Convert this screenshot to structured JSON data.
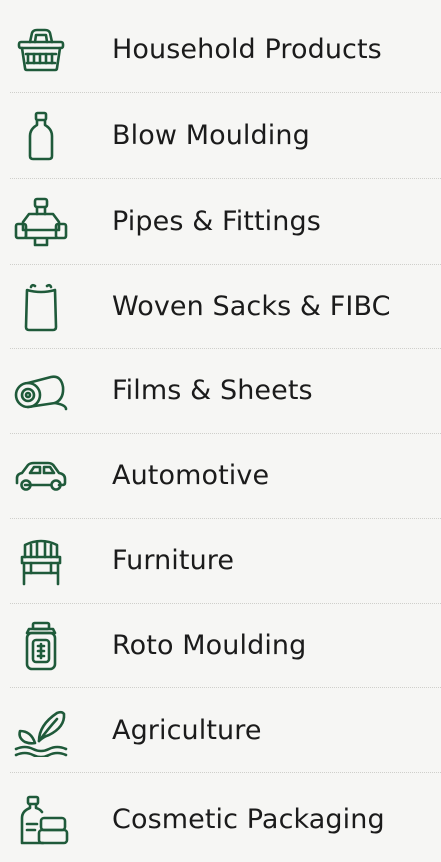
{
  "categories": [
    {
      "label": "Household Products",
      "icon": "basket-icon"
    },
    {
      "label": "Blow Moulding",
      "icon": "bottle-icon"
    },
    {
      "label": "Pipes & Fittings",
      "icon": "pipe-fittings-icon"
    },
    {
      "label": "Woven Sacks & FIBC",
      "icon": "sack-icon"
    },
    {
      "label": "Films & Sheets",
      "icon": "film-roll-icon"
    },
    {
      "label": "Automotive",
      "icon": "car-icon"
    },
    {
      "label": "Furniture",
      "icon": "chair-icon"
    },
    {
      "label": "Roto Moulding",
      "icon": "tank-icon"
    },
    {
      "label": "Agriculture",
      "icon": "plant-icon"
    },
    {
      "label": "Cosmetic Packaging",
      "icon": "cosmetic-bottle-icon"
    }
  ],
  "colors": {
    "icon": "#1f5a3a",
    "text": "#1b1b1b",
    "background": "#f6f6f4",
    "divider": "#cfcfcb"
  }
}
